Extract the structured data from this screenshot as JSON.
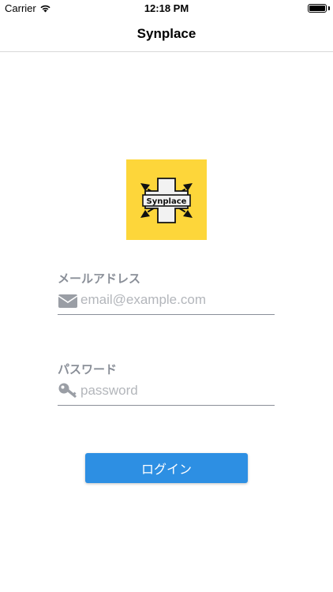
{
  "status_bar": {
    "carrier": "Carrier",
    "time": "12:18 PM"
  },
  "nav": {
    "title": "Synplace"
  },
  "logo": {
    "text": "Synplace",
    "background_color": "#fdd63a"
  },
  "email_field": {
    "label": "メールアドレス",
    "placeholder": "email@example.com",
    "icon": "envelope-icon"
  },
  "password_field": {
    "label": "パスワード",
    "placeholder": "password",
    "icon": "key-icon"
  },
  "login_button": {
    "label": "ログイン",
    "color": "#2d8fe3"
  }
}
